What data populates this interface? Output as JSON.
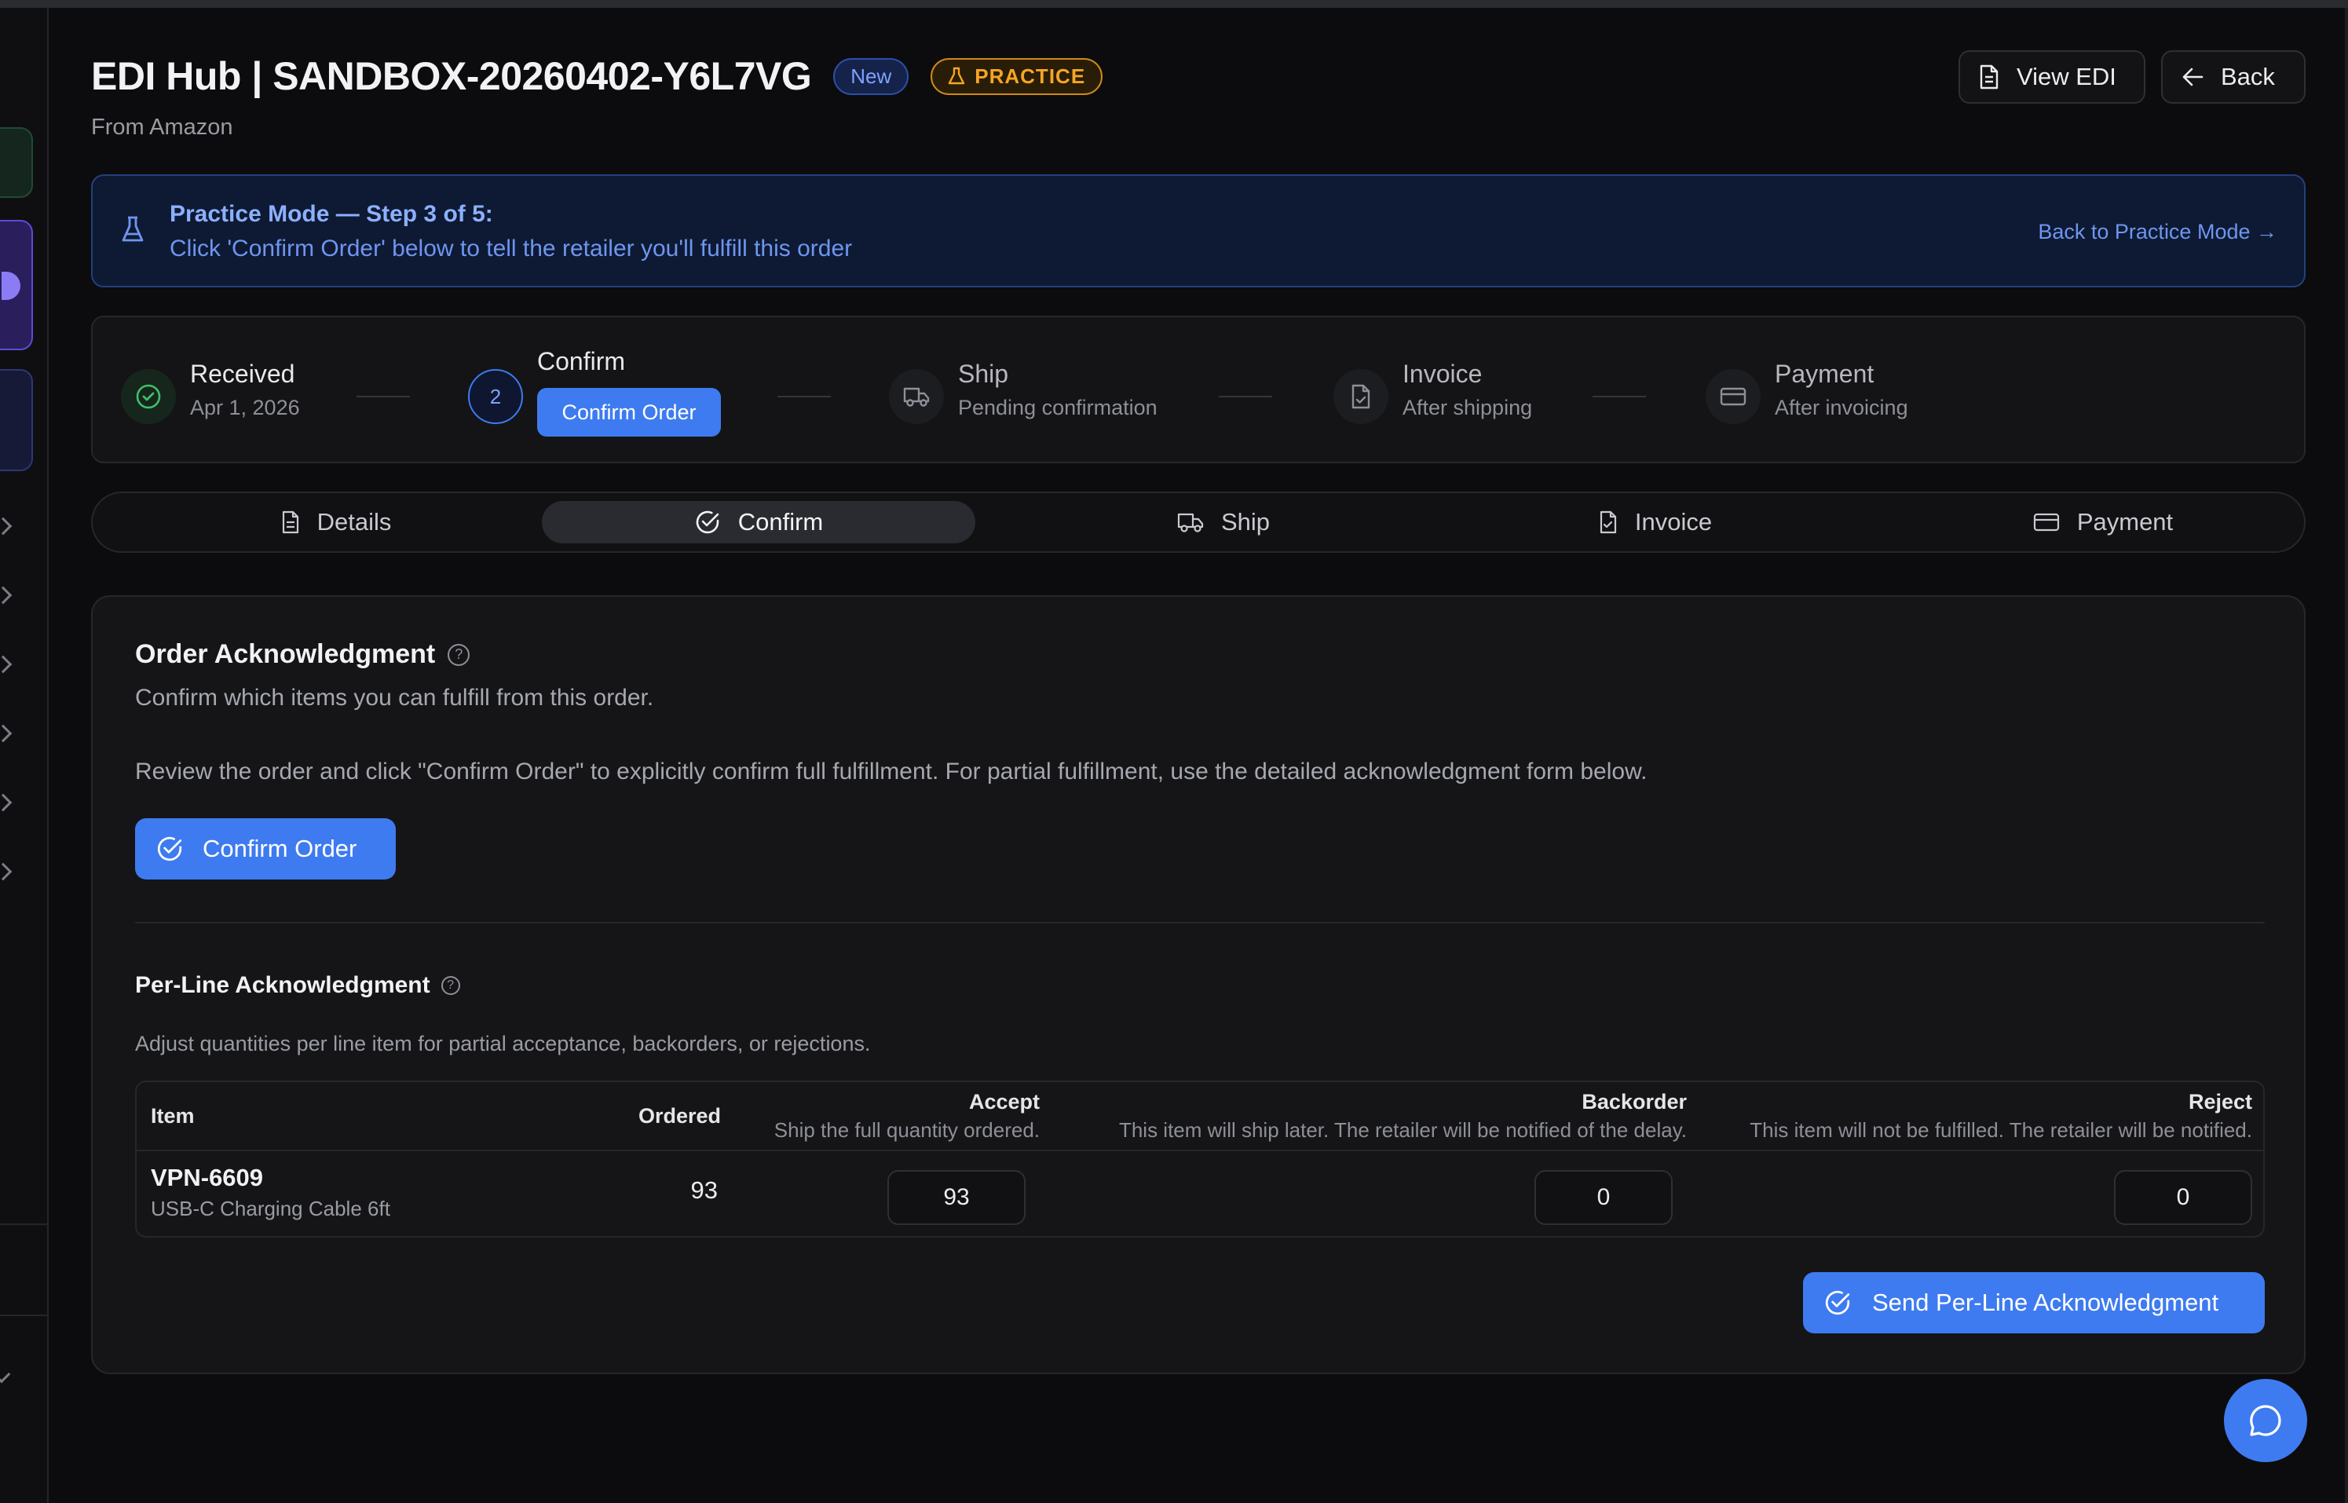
{
  "header": {
    "title": "EDI Hub | SANDBOX-20260402-Y6L7VG",
    "status_badge": "New",
    "practice_badge": "PRACTICE",
    "subtitle": "From Amazon",
    "view_edi_label": "View EDI",
    "back_label": "Back"
  },
  "banner": {
    "title": "Practice Mode — Step 3 of 5:",
    "text": "Click 'Confirm Order' below to tell the retailer you'll fulfill this order",
    "link": "Back to Practice Mode →"
  },
  "stepper": {
    "steps": [
      {
        "label": "Received",
        "sub": "Apr 1, 2026",
        "state": "done"
      },
      {
        "label": "Confirm",
        "number": "2",
        "action": "Confirm Order",
        "state": "current"
      },
      {
        "label": "Ship",
        "sub": "Pending confirmation",
        "state": "pending"
      },
      {
        "label": "Invoice",
        "sub": "After shipping",
        "state": "pending"
      },
      {
        "label": "Payment",
        "sub": "After invoicing",
        "state": "pending"
      }
    ]
  },
  "tabs": [
    {
      "label": "Details",
      "icon": "document-icon"
    },
    {
      "label": "Confirm",
      "icon": "check-circle-icon",
      "active": true
    },
    {
      "label": "Ship",
      "icon": "truck-icon"
    },
    {
      "label": "Invoice",
      "icon": "file-check-icon"
    },
    {
      "label": "Payment",
      "icon": "credit-card-icon"
    }
  ],
  "ack": {
    "title": "Order Acknowledgment",
    "description": "Confirm which items you can fulfill from this order.",
    "review_text": "Review the order and click \"Confirm Order\" to explicitly confirm full fulfillment. For partial fulfillment, use the detailed acknowledgment form below.",
    "confirm_label": "Confirm Order"
  },
  "per_line": {
    "title": "Per-Line Acknowledgment",
    "description": "Adjust quantities per line item for partial acceptance, backorders, or rejections.",
    "columns": {
      "item": "Item",
      "ordered": "Ordered",
      "accept": "Accept",
      "accept_sub": "Ship the full quantity ordered.",
      "backorder": "Backorder",
      "backorder_sub": "This item will ship later. The retailer will be notified of the delay.",
      "reject": "Reject",
      "reject_sub": "This item will not be fulfilled. The retailer will be notified."
    },
    "rows": [
      {
        "item": "VPN-6609",
        "desc": "USB-C Charging Cable 6ft",
        "ordered": "93",
        "accept": "93",
        "backorder": "0",
        "reject": "0"
      }
    ],
    "send_label": "Send Per-Line Acknowledgment"
  },
  "colors": {
    "accent": "#3e7bf0",
    "practice": "#f5a623",
    "success": "#3fbf6a"
  }
}
